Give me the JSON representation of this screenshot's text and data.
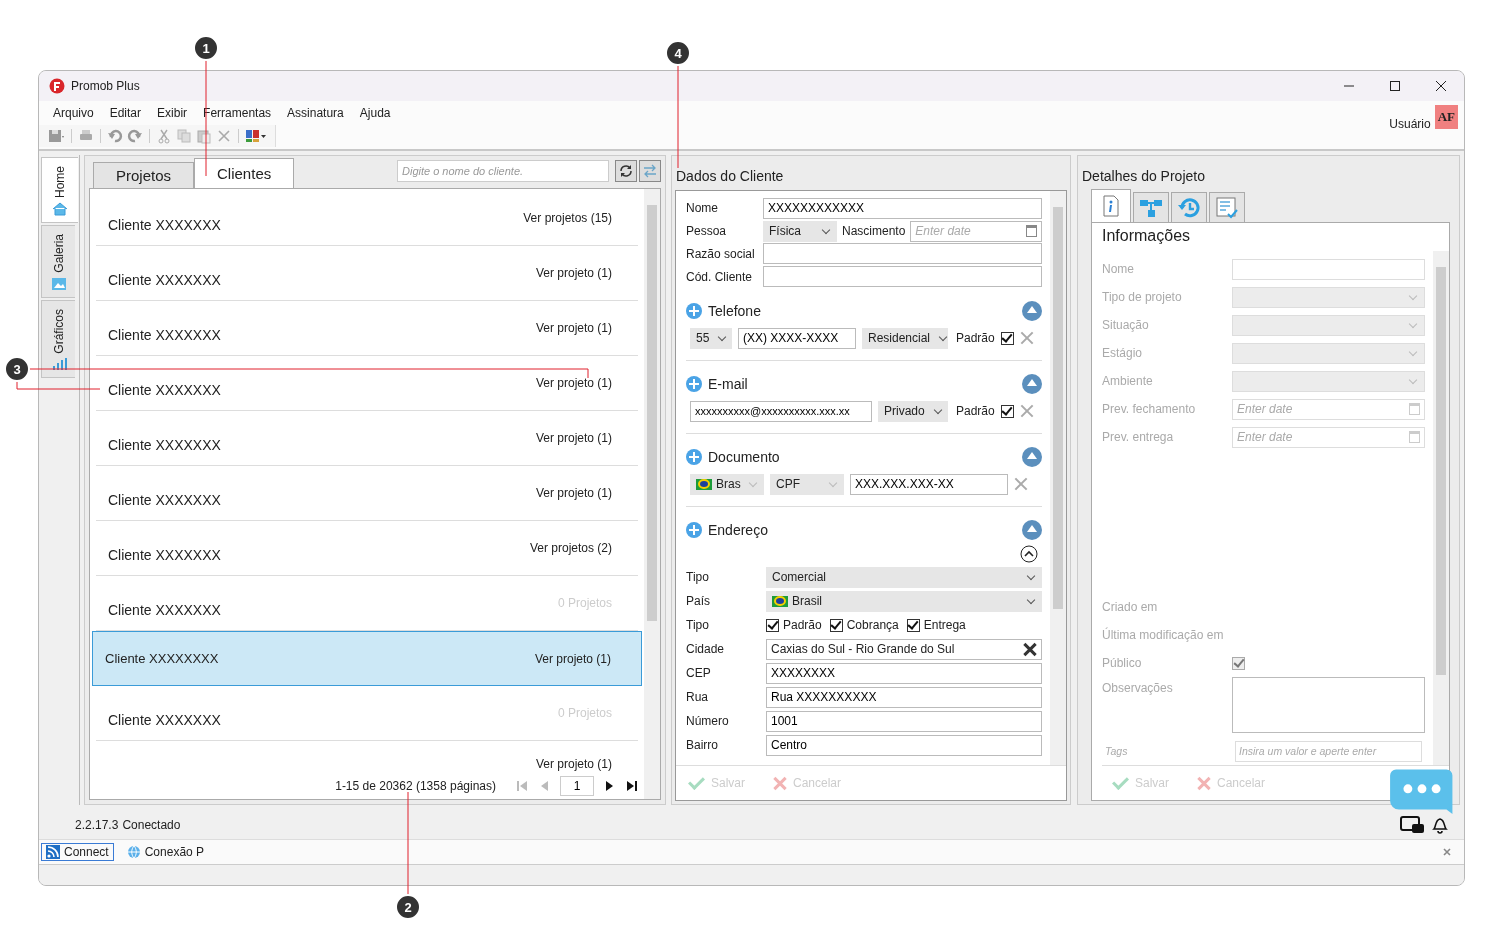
{
  "window": {
    "title": "Promob Plus",
    "user": "Usuário",
    "avatar": "AF"
  },
  "menu": [
    "Arquivo",
    "Editar",
    "Exibir",
    "Ferramentas",
    "Assinatura",
    "Ajuda"
  ],
  "side_tabs": [
    {
      "label": "Home",
      "selected": true
    },
    {
      "label": "Galeria",
      "selected": false
    },
    {
      "label": "Gráficos",
      "selected": false
    }
  ],
  "list_panel": {
    "tabs": [
      {
        "label": "Projetos",
        "selected": false
      },
      {
        "label": "Clientes",
        "selected": true
      }
    ],
    "search": {
      "placeholder": "Digite o nome do cliente."
    },
    "rows": [
      {
        "name": "Cliente XXXXXXX",
        "projects": "Ver projetos (15)",
        "disabled": false,
        "selected": false
      },
      {
        "name": "Cliente XXXXXXX",
        "projects": "Ver projeto (1)",
        "disabled": false,
        "selected": false
      },
      {
        "name": "Cliente XXXXXXX",
        "projects": "Ver projeto (1)",
        "disabled": false,
        "selected": false
      },
      {
        "name": "Cliente XXXXXXX",
        "projects": "Ver projeto (1)",
        "disabled": false,
        "selected": false
      },
      {
        "name": "Cliente XXXXXXX",
        "projects": "Ver projeto (1)",
        "disabled": false,
        "selected": false
      },
      {
        "name": "Cliente XXXXXXX",
        "projects": "Ver projeto (1)",
        "disabled": false,
        "selected": false
      },
      {
        "name": "Cliente XXXXXXX",
        "projects": "Ver projetos (2)",
        "disabled": false,
        "selected": false
      },
      {
        "name": "Cliente XXXXXXX",
        "projects": "0 Projetos",
        "disabled": true,
        "selected": false
      },
      {
        "name": "Cliente XXXXXXXX",
        "projects": "Ver projeto (1)",
        "disabled": false,
        "selected": true
      },
      {
        "name": "Cliente XXXXXXX",
        "projects": "0 Projetos",
        "disabled": true,
        "selected": false
      },
      {
        "projects": "Ver projeto (1)",
        "disabled": false,
        "selected": false
      }
    ],
    "pager": {
      "summary": "1-15 de 20362 (1358 páginas)",
      "page": "1"
    }
  },
  "client": {
    "title": "Dados do Cliente",
    "nome": {
      "label": "Nome",
      "value": "XXXXXXXXXXXX"
    },
    "pessoa": {
      "label": "Pessoa",
      "value": "Física"
    },
    "nascimento": {
      "label": "Nascimento",
      "placeholder": "Enter date"
    },
    "razao": {
      "label": "Razão social"
    },
    "codigo": {
      "label": "Cód. Cliente"
    },
    "telefone": {
      "title": "Telefone",
      "ddi": "55",
      "number": "(XX) XXXX-XXXX",
      "type": "Residencial",
      "default_label": "Padrão",
      "default": true
    },
    "email": {
      "title": "E-mail",
      "value": "xxxxxxxxxx@xxxxxxxxxx.xxx.xx",
      "type": "Privado",
      "default_label": "Padrão",
      "default": true
    },
    "documento": {
      "title": "Documento",
      "country": "Bras",
      "type": "CPF",
      "value": "XXX.XXX.XXX-XX"
    },
    "endereco": {
      "title": "Endereço",
      "rows": [
        {
          "kind": "select",
          "label": "Tipo",
          "value": "Comercial"
        },
        {
          "kind": "country",
          "label": "País",
          "value": "Brasil"
        },
        {
          "kind": "checks",
          "label": "Tipo",
          "options": [
            {
              "label": "Padrão",
              "checked": true
            },
            {
              "label": "Cobrança",
              "checked": true
            },
            {
              "label": "Entrega",
              "checked": true
            }
          ]
        },
        {
          "kind": "clearable",
          "label": "Cidade",
          "value": "Caxias do Sul - Rio Grande do Sul"
        },
        {
          "kind": "text",
          "label": "CEP",
          "value": "XXXXXXXX"
        },
        {
          "kind": "text",
          "label": "Rua",
          "value": "Rua XXXXXXXXXX"
        },
        {
          "kind": "text",
          "label": "Número",
          "value": "1001"
        },
        {
          "kind": "text",
          "label": "Bairro",
          "value": "Centro"
        }
      ]
    },
    "buttons": [
      {
        "label": "Salvar",
        "kind": "save",
        "disabled": true
      },
      {
        "label": "Cancelar",
        "kind": "cancel",
        "disabled": true
      }
    ]
  },
  "project": {
    "title": "Detalhes do Projeto",
    "tabs": [
      {
        "selected": true
      },
      {
        "selected": false
      },
      {
        "selected": false
      },
      {
        "selected": false
      }
    ],
    "heading": "Informações",
    "fields": [
      {
        "kind": "text",
        "label": "Nome"
      },
      {
        "kind": "select",
        "label": "Tipo de projeto"
      },
      {
        "kind": "select",
        "label": "Situação"
      },
      {
        "kind": "select",
        "label": "Estágio"
      },
      {
        "kind": "select",
        "label": "Ambiente"
      },
      {
        "kind": "date",
        "label": "Prev. fechamento",
        "placeholder": "Enter date"
      },
      {
        "kind": "date",
        "label": "Prev. entrega",
        "placeholder": "Enter date"
      }
    ],
    "meta": [
      {
        "kind": "label",
        "label": "Criado em"
      },
      {
        "kind": "label",
        "label": "Última modificação em"
      },
      {
        "kind": "check",
        "label": "Público",
        "checked": true
      },
      {
        "kind": "textarea",
        "label": "Observações"
      },
      {
        "kind": "tags",
        "label": "Tags",
        "placeholder": "Insira um valor e aperte enter"
      }
    ],
    "buttons": [
      {
        "label": "Salvar",
        "kind": "save",
        "disabled": true
      },
      {
        "label": "Cancelar",
        "kind": "cancel",
        "disabled": true
      }
    ]
  },
  "status": {
    "version": "2.2.17.3",
    "state": "Conectado"
  },
  "connections": [
    {
      "label": "Connect",
      "selected": true
    },
    {
      "label": "Conexão P",
      "selected": false
    }
  ],
  "callouts": [
    "1",
    "2",
    "3",
    "4"
  ]
}
